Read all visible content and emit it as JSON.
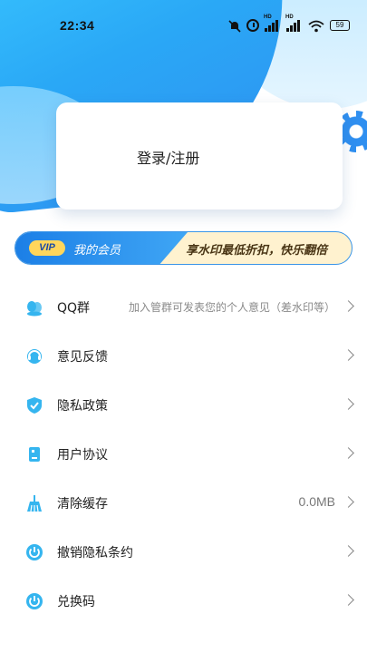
{
  "status_bar": {
    "time": "22:34",
    "battery": "59",
    "signal_badge": "HD"
  },
  "login": {
    "label": "登录/注册"
  },
  "vip": {
    "badge": "VIP",
    "member_label": "我的会员",
    "promo": "享水印最低折扣，快乐翻倍"
  },
  "menu": {
    "items": [
      {
        "label": "QQ群",
        "detail": "加入管群可发表您的个人意见（差水印等）",
        "icon": "qq-group-icon"
      },
      {
        "label": "意见反馈",
        "detail": "",
        "icon": "feedback-icon"
      },
      {
        "label": "隐私政策",
        "detail": "",
        "icon": "shield-check-icon"
      },
      {
        "label": "用户协议",
        "detail": "",
        "icon": "document-icon"
      },
      {
        "label": "清除缓存",
        "detail": "0.0MB",
        "icon": "broom-icon"
      },
      {
        "label": "撤销隐私条约",
        "detail": "",
        "icon": "power-icon"
      },
      {
        "label": "兑换码",
        "detail": "",
        "icon": "power-icon"
      }
    ]
  },
  "colors": {
    "accent": "#2aa8f6",
    "icon": "#35b5ef",
    "vip_gold": "#ffd65c",
    "vip_bg": "#fff2cf"
  }
}
